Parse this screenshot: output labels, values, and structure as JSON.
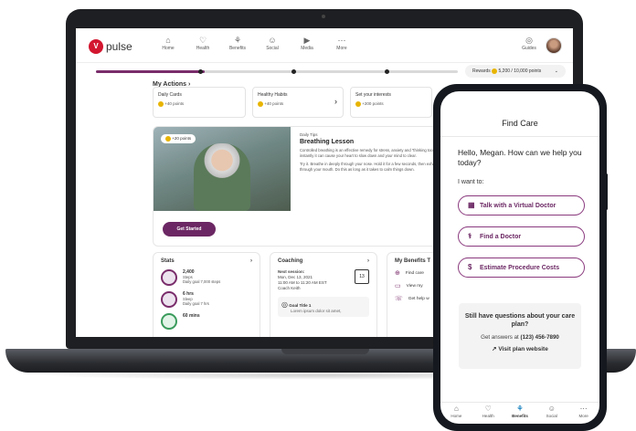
{
  "desktop": {
    "logo": {
      "mark": "V",
      "text": "pulse"
    },
    "nav": [
      {
        "icon": "⌂",
        "label": "Home"
      },
      {
        "icon": "♡",
        "label": "Health"
      },
      {
        "icon": "⚘",
        "label": "Benefits"
      },
      {
        "icon": "☺",
        "label": "Social"
      },
      {
        "icon": "▶",
        "label": "Media"
      },
      {
        "icon": "⋯",
        "label": "More"
      }
    ],
    "guides_label": "Guides",
    "progress_fraction": 0.3,
    "rewards": {
      "label": "Rewards",
      "points": "5,200 / 10,000 points"
    },
    "my_actions": {
      "title": "My Actions",
      "cards": [
        {
          "title": "Daily Cards",
          "points": "+40 points"
        },
        {
          "title": "Healthy Habits",
          "points": "+40 points"
        },
        {
          "title": "Set your interests",
          "points": "+200 points"
        }
      ]
    },
    "daily_tip": {
      "points_chip": "+20 points",
      "eyebrow": "Daily Tips",
      "title": "Breathing Lesson",
      "text1": "Controlled breathing is an effective remedy for stress, anxiety and \"thinking too much.\" Almost instantly it can cause your heart to slow down and your mind to clear.",
      "text2": "Try it. Breathe in deeply through your nose. Hold it for a few seconds, then exhale slowly through your mouth. Do this as long as it takes to calm things down.",
      "cta": "Get Started"
    },
    "stats": {
      "title": "Stats",
      "rows": [
        {
          "value": "2,400",
          "unit": "Steps",
          "goal": "Daily goal 7,000 steps"
        },
        {
          "value": "6 hrs",
          "unit": "Sleep",
          "goal": "Daily goal 7 hrs"
        },
        {
          "value": "60 mins",
          "unit": "",
          "goal": ""
        }
      ]
    },
    "coaching": {
      "title": "Coaching",
      "next": "Next session:",
      "date": "Mon, Dec 13, 2021",
      "time": "11:00 AM to 11:20 AM EST",
      "coach": "Coach Keith",
      "calendar_day": "13",
      "goal_title": "Goal Title 1",
      "goal_text": "Lorem ipsum dolor sit amet,"
    },
    "benefits": {
      "title": "My Benefits T",
      "rows": [
        {
          "icon": "⊕",
          "label": "Find care"
        },
        {
          "icon": "▭",
          "label": "View my"
        },
        {
          "icon": "☏",
          "label": "Get help w"
        }
      ]
    }
  },
  "phone": {
    "title": "Find Care",
    "greeting": "Hello, Megan. How can we help you today?",
    "prompt": "I want to:",
    "options": [
      {
        "icon": "▦",
        "label": "Talk with a Virtual Doctor"
      },
      {
        "icon": "⚕",
        "label": "Find a Doctor"
      },
      {
        "icon": "$",
        "label": "Estimate Procedure Costs"
      }
    ],
    "help": {
      "title": "Still have questions about your care plan?",
      "call_prefix": "Get answers at",
      "phone_number": "(123) 456-7890",
      "link_icon": "↗",
      "link": "Visit plan website"
    },
    "tabs": [
      {
        "icon": "⌂",
        "label": "Home"
      },
      {
        "icon": "♡",
        "label": "Health"
      },
      {
        "icon": "⚘",
        "label": "Benefits"
      },
      {
        "icon": "☺",
        "label": "Social"
      },
      {
        "icon": "⋯",
        "label": "More"
      }
    ],
    "active_tab": "Benefits",
    "accent_color": "#6b2763"
  }
}
